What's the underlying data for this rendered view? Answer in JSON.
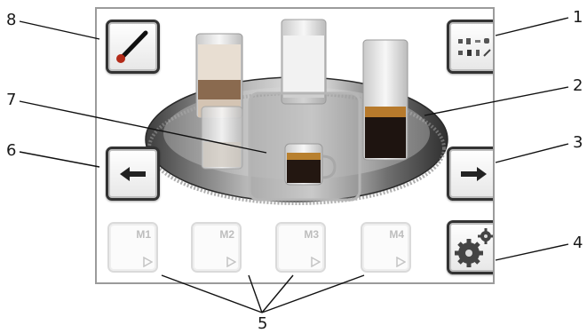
{
  "callouts": [
    "8",
    "1",
    "7",
    "2",
    "6",
    "3",
    "4",
    "5"
  ],
  "memory_buttons": [
    "M1",
    "M2",
    "M3",
    "M4"
  ],
  "icons": {
    "top_left": "spout-wand-icon",
    "top_right": "beverage-menu-icon",
    "left": "arrow-left-icon",
    "right": "arrow-right-icon",
    "settings": "gears-icon"
  },
  "colors": {
    "button_border": "#333333",
    "screen_border": "#9b9b9b",
    "memory_label": "#bdbdbd"
  }
}
